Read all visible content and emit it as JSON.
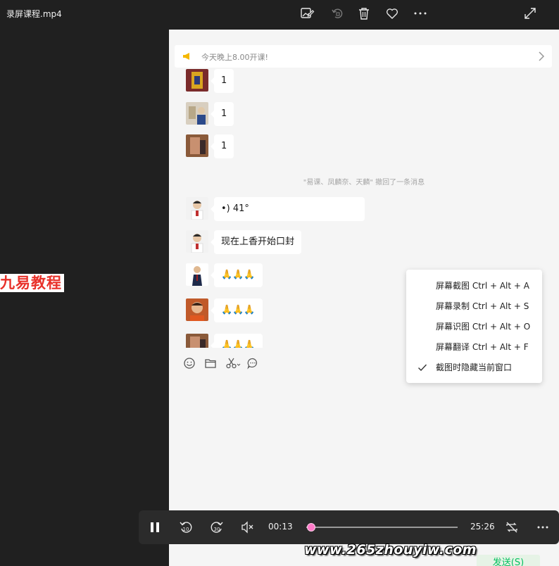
{
  "window": {
    "title": "录屏课程.mp4"
  },
  "top_icons": [
    "edit-image-icon",
    "rotate-icon",
    "delete-icon",
    "favorite-icon",
    "more-options-icon",
    "fullscreen-icon"
  ],
  "brand_label": "九易教程",
  "chat": {
    "notice": "今天晚上8.00开课!",
    "messages": [
      {
        "text": "1"
      },
      {
        "text": "1"
      },
      {
        "text": "1"
      },
      {
        "text": "•)    41°"
      },
      {
        "text": "现在上香开始口封"
      },
      {
        "text": "🙏🙏🙏"
      },
      {
        "text": "🙏🙏🙏"
      },
      {
        "text": "🙏🙏🙏"
      }
    ],
    "system_message": "\"易课、凤麟奈、天麟\" 撤回了一条消息",
    "toolbar_icons": [
      "emoji-icon",
      "folder-icon",
      "scissors-icon",
      "chat-history-icon"
    ]
  },
  "context_menu": {
    "items": [
      {
        "label": "屏幕截图 Ctrl + Alt + A"
      },
      {
        "label": "屏幕录制 Ctrl + Alt + S"
      },
      {
        "label": "屏幕识图 Ctrl + Alt + O"
      },
      {
        "label": "屏幕翻译 Ctrl + Alt + F"
      },
      {
        "label": "截图时隐藏当前窗口",
        "checked": true
      }
    ]
  },
  "send_button": "发送(S)",
  "player": {
    "current_time": "00:13",
    "duration": "25:26",
    "progress": 0.0085
  },
  "watermark": "www.265zhouyiw.com",
  "colors": {
    "accent": "#ff7ac8",
    "brand": "#e8312a",
    "wechat_green": "#07c160"
  }
}
